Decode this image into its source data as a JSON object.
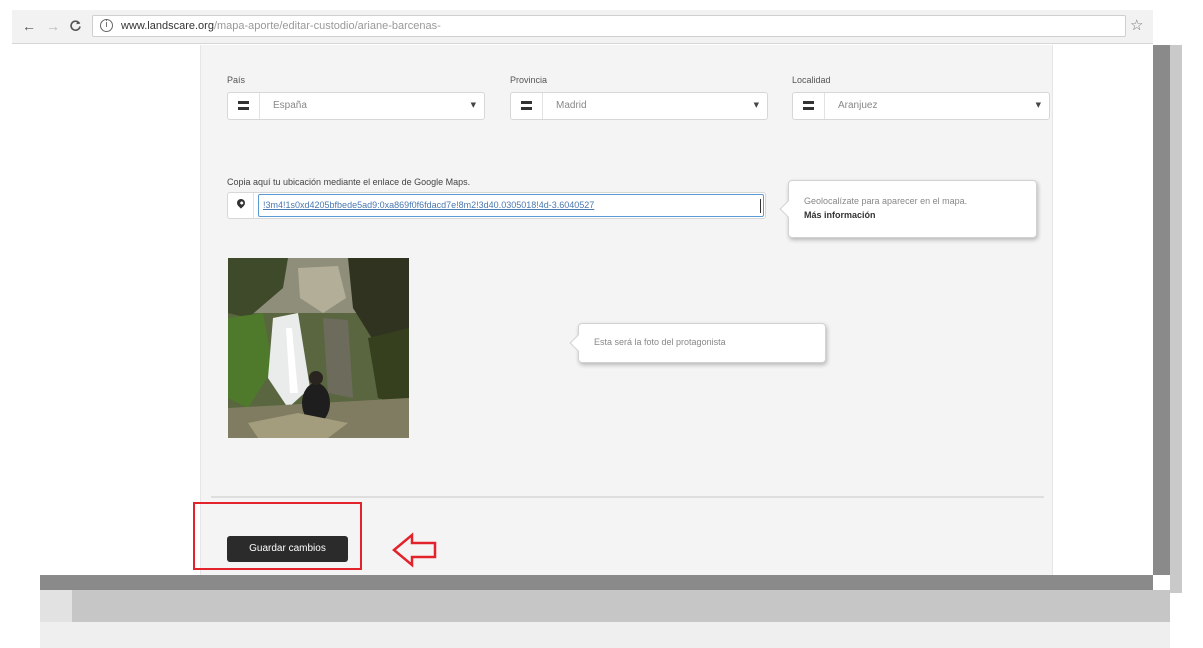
{
  "browser": {
    "url_host": "www.landscare.org",
    "url_path": "/mapa-aporte/editar-custodio/ariane-barcenas-"
  },
  "form": {
    "country": {
      "label": "País",
      "value": "España"
    },
    "province": {
      "label": "Provincia",
      "value": "Madrid"
    },
    "locality": {
      "label": "Localidad",
      "value": "Aranjuez"
    },
    "maps": {
      "label": "Copia aquí tu ubicación mediante el enlace de Google Maps.",
      "value": "!3m4!1s0xd4205bfbede5ad9:0xa869f0f6fdacd7e!8m2!3d40.0305018!4d-3.6040527"
    },
    "geo_tooltip": {
      "text": "Geolocalízate para aparecer en el mapa.",
      "link": "Más información"
    },
    "photo_tooltip": {
      "text": "Esta será la foto del protagonista"
    },
    "save_label": "Guardar cambios"
  },
  "colors": {
    "highlight": "#e3232c",
    "button": "#2b2b2b",
    "link": "#4a78b0",
    "focus_border": "#5b9bd5"
  },
  "icons": [
    "back-arrow-icon",
    "forward-arrow-icon",
    "reload-icon",
    "info-icon",
    "star-icon",
    "list-icon",
    "caret-down-icon",
    "map-pin-icon",
    "outline-left-arrow-icon"
  ]
}
